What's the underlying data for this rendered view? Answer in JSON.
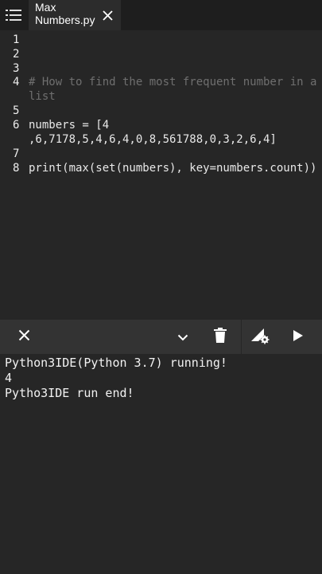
{
  "colors": {
    "background": "#262626",
    "topbar": "#1e1e1e",
    "toolbar": "#333333",
    "comment": "#6f6f6f",
    "text": "#e8e8e8"
  },
  "topbar": {
    "menu_icon": "hamburger-menu-icon",
    "tab": {
      "title": "Max\nNumbers.py",
      "close_icon": "close-icon"
    }
  },
  "editor": {
    "lines": [
      {
        "num": "1",
        "text": ""
      },
      {
        "num": "2",
        "text": ""
      },
      {
        "num": "3",
        "text": ""
      },
      {
        "num": "4",
        "text": "# How to find the most frequent number in a",
        "wrap": "list",
        "kind": "comment"
      },
      {
        "num": "5",
        "text": ""
      },
      {
        "num": "6",
        "text": "numbers = [4",
        "wrap": ",6,7178,5,4,6,4,0,8,561788,0,3,2,6,4]"
      },
      {
        "num": "7",
        "text": ""
      },
      {
        "num": "8",
        "text": "print(max(set(numbers), key=numbers.count))"
      }
    ]
  },
  "toolbar": {
    "close_icon": "close-icon",
    "collapse_icon": "chevron-down-icon",
    "delete_icon": "trash-icon",
    "settings_icon": "run-settings-icon",
    "run_icon": "play-icon"
  },
  "console": {
    "lines": [
      "Python3IDE(Python 3.7) running!",
      "4",
      "Pytho3IDE run end!"
    ]
  }
}
